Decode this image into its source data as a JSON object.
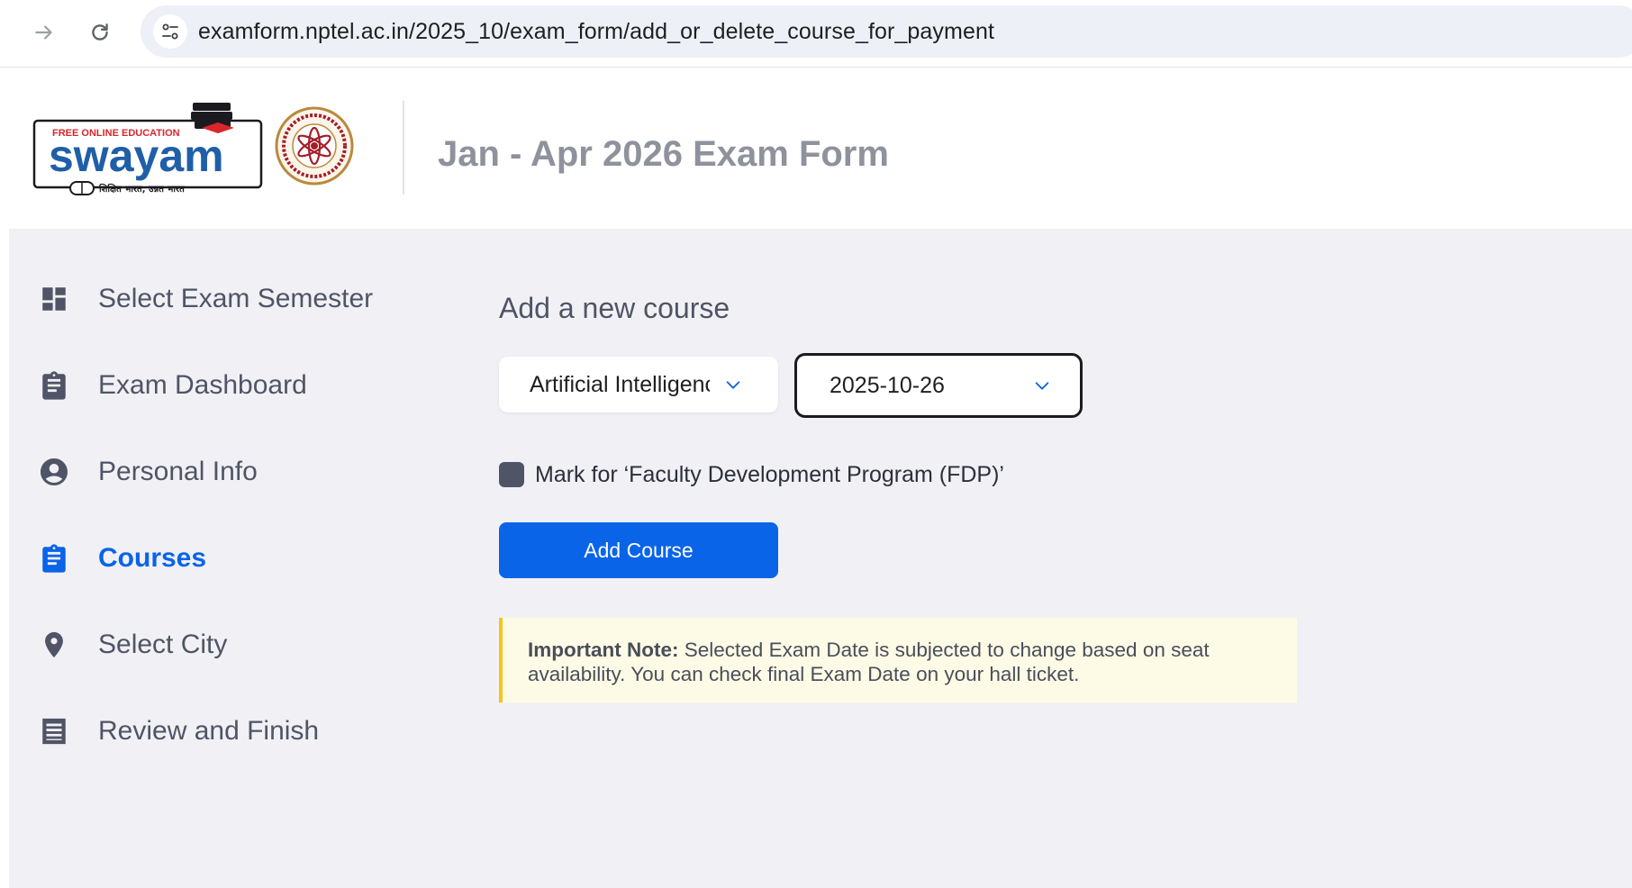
{
  "browser": {
    "url": "examform.nptel.ac.in/2025_10/exam_form/add_or_delete_course_for_payment"
  },
  "header": {
    "logo_tagline": "FREE ONLINE EDUCATION",
    "logo_text": "swayam",
    "logo_hindi": "शिक्षित भारत, उन्नत भारत",
    "title": "Jan - Apr 2026 Exam Form"
  },
  "sidebar": {
    "items": [
      {
        "label": "Select Exam Semester",
        "icon": "dashboard-icon",
        "active": false
      },
      {
        "label": "Exam Dashboard",
        "icon": "clipboard-icon",
        "active": false
      },
      {
        "label": "Personal Info",
        "icon": "account-circle-icon",
        "active": false
      },
      {
        "label": "Courses",
        "icon": "clipboard-icon",
        "active": true
      },
      {
        "label": "Select City",
        "icon": "location-pin-icon",
        "active": false
      },
      {
        "label": "Review and Finish",
        "icon": "list-receipt-icon",
        "active": false
      }
    ]
  },
  "main": {
    "section_title": "Add a new course",
    "course_select": {
      "value": "Artificial Intelligence"
    },
    "date_select": {
      "value": "2025-10-26"
    },
    "fdp_label": "Mark for ‘Faculty Development Program (FDP)’",
    "add_button_label": "Add Course",
    "note": {
      "strong": "Important Note:",
      "text": " Selected Exam Date is subjected to change based on seat availability. You can check final Exam Date on your hall ticket."
    }
  },
  "colors": {
    "accent": "#0a64e8",
    "sidebar_text": "#4f5466",
    "note_border": "#f5c518",
    "note_bg": "#fdfbe6"
  }
}
